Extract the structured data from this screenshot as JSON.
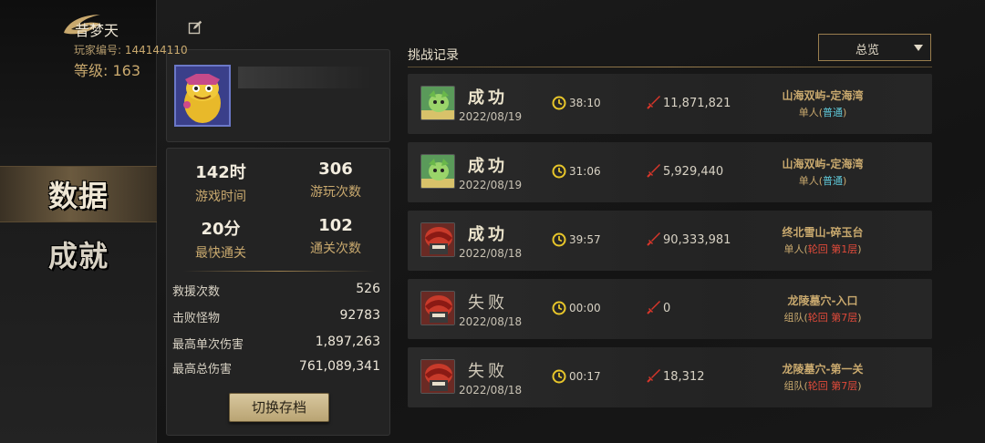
{
  "sidebar": {
    "nav": [
      {
        "label": "数据",
        "active": true
      },
      {
        "label": "成就",
        "active": false
      }
    ]
  },
  "profile": {
    "nickname": "昔梦天",
    "player_id_label": "玩家编号:",
    "player_id": "144144110",
    "level_label": "等级:",
    "level": "163"
  },
  "stats": {
    "top": [
      {
        "value": "142时",
        "label": "游戏时间"
      },
      {
        "value": "306",
        "label": "游玩次数"
      },
      {
        "value": "20分",
        "label": "最快通关"
      },
      {
        "value": "102",
        "label": "通关次数"
      }
    ],
    "rows": [
      {
        "label": "救援次数",
        "value": "526"
      },
      {
        "label": "击败怪物",
        "value": "92783"
      },
      {
        "label": "最高单次伤害",
        "value": "1,897,263"
      },
      {
        "label": "最高总伤害",
        "value": "761,089,341"
      }
    ],
    "switch_button": "切换存档"
  },
  "records": {
    "title": "挑战记录",
    "filter": "总览",
    "items": [
      {
        "result": "成功",
        "success": true,
        "date": "2022/08/19",
        "time": "38:10",
        "damage": "11,871,821",
        "stage": "山海双屿-定海湾",
        "mode": "单人",
        "lp": "(",
        "difficulty": "普通",
        "rp": ")",
        "diff_type": "normal",
        "portrait": "green"
      },
      {
        "result": "成功",
        "success": true,
        "date": "2022/08/19",
        "time": "31:06",
        "damage": "5,929,440",
        "stage": "山海双屿-定海湾",
        "mode": "单人",
        "lp": "(",
        "difficulty": "普通",
        "rp": ")",
        "diff_type": "normal",
        "portrait": "green"
      },
      {
        "result": "成功",
        "success": true,
        "date": "2022/08/18",
        "time": "39:57",
        "damage": "90,333,981",
        "stage": "终北雪山-碎玉台",
        "mode": "单人",
        "lp": "(",
        "difficulty": "轮回 第1层",
        "rp": ")",
        "diff_type": "hard",
        "portrait": "red"
      },
      {
        "result": "失败",
        "success": false,
        "date": "2022/08/18",
        "time": "00:00",
        "damage": "0",
        "stage": "龙陵墓穴-入口",
        "mode": "组队",
        "lp": "(",
        "difficulty": "轮回 第7层",
        "rp": ")",
        "diff_type": "hard",
        "portrait": "red"
      },
      {
        "result": "失败",
        "success": false,
        "date": "2022/08/18",
        "time": "00:17",
        "damage": "18,312",
        "stage": "龙陵墓穴-第一关",
        "mode": "组队",
        "lp": "(",
        "difficulty": "轮回 第7层",
        "rp": ")",
        "diff_type": "hard",
        "portrait": "red"
      }
    ]
  },
  "colors": {
    "gold": "#c9a96e",
    "normal_difficulty": "#5fc9d9",
    "hard_difficulty": "#e04a3a"
  },
  "icons": [
    "game-logo-icon",
    "edit-icon",
    "clock-icon",
    "sword-icon",
    "chevron-down-icon"
  ]
}
